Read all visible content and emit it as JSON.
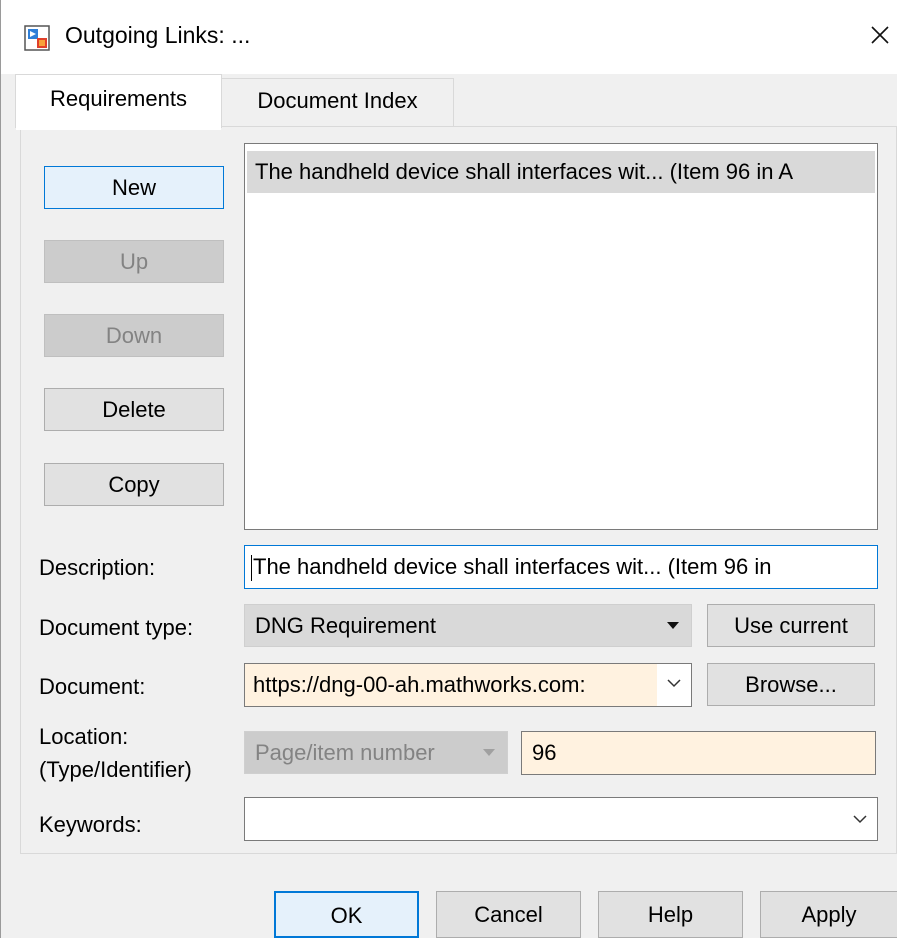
{
  "window": {
    "title": "Outgoing Links: ...",
    "close_glyph": "✕"
  },
  "tabs": [
    {
      "label": "Requirements",
      "active": true
    },
    {
      "label": "Document Index",
      "active": false
    }
  ],
  "side_buttons": {
    "new": "New",
    "up": "Up",
    "down": "Down",
    "delete": "Delete",
    "copy": "Copy"
  },
  "links_list": [
    "The handheld device shall interfaces wit... (Item 96 in A"
  ],
  "form": {
    "description_label": "Description:",
    "description_value": "The handheld device shall interfaces wit... (Item 96 in",
    "doctype_label": "Document type:",
    "doctype_value": "DNG Requirement",
    "use_current": "Use current",
    "document_label": "Document:",
    "document_value": "https://dng-00-ah.mathworks.com:",
    "browse": "Browse...",
    "location_label_1": "Location:",
    "location_label_2": "(Type/Identifier)",
    "location_type": "Page/item number",
    "location_id": "96",
    "keywords_label": "Keywords:",
    "keywords_value": ""
  },
  "footer": {
    "ok": "OK",
    "cancel": "Cancel",
    "help": "Help",
    "apply": "Apply"
  },
  "colors": {
    "accent": "#0078d7",
    "highlight_field": "#fff2e0",
    "selection": "#d9d9d9"
  }
}
